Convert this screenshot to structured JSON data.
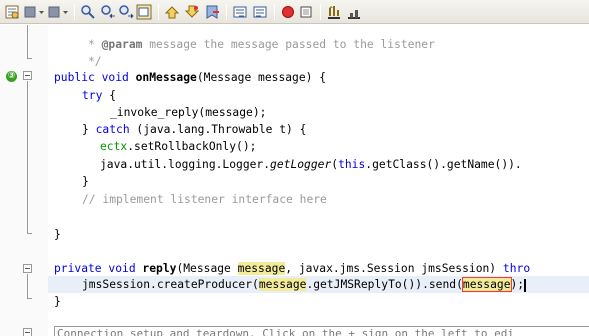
{
  "toolbar": {
    "icons": [
      "history-icon",
      "back-icon",
      "forward-icon",
      "find-icon",
      "find-previous-icon",
      "find-next-icon",
      "toggle-highlight-icon",
      "shift-left-icon",
      "shift-right-icon",
      "toggle-bookmark-icon",
      "previous-bookmark-icon",
      "next-bookmark-icon",
      "uncomment-icon",
      "comment-icon",
      "start-macro-icon",
      "stop-macro-icon",
      "run-icon",
      "chart-icon"
    ],
    "colors": {
      "record": "#e03030"
    }
  },
  "gutter": {
    "annotation_badge": "③"
  },
  "code": {
    "l1_a": "     * ",
    "l1_tag": "@param",
    "l1_b": " message the message passed to the listener",
    "l2": "     */",
    "l3_kw": "public void ",
    "l3_name": "onMessage",
    "l3_rest": "(Message message) {",
    "l4_kw": "try",
    "l4_rest": " {",
    "l5": "_invoke_reply(message);",
    "l6_a": "} ",
    "l6_kw": "catch",
    "l6_b": " (java.lang.Throwable t) {",
    "l7_field": "ectx",
    "l7_rest": ".setRollbackOnly();",
    "l8_a": "java.util.logging.Logger.",
    "l8_it": "getLogger",
    "l8_b": "(",
    "l8_kw": "this",
    "l8_c": ".getClass().getName()).",
    "l9": "}",
    "l10": "// implement listener interface here",
    "l11": "}",
    "l12_kw": "private void ",
    "l12_name": "reply",
    "l12_a": "(Message ",
    "l12_hl": "message",
    "l12_b": ", javax.jms.Session jmsSession) ",
    "l12_kw2": "thro",
    "l13_a": "jmsSession.createProducer(",
    "l13_hl": "message",
    "l13_b": ".getJMSReplyTo()).send(",
    "l13_hl2": "message",
    "l13_c": ");",
    "l14": "}",
    "collapsed": "Connection setup and teardown. Click on the + sign on the left to edi"
  }
}
